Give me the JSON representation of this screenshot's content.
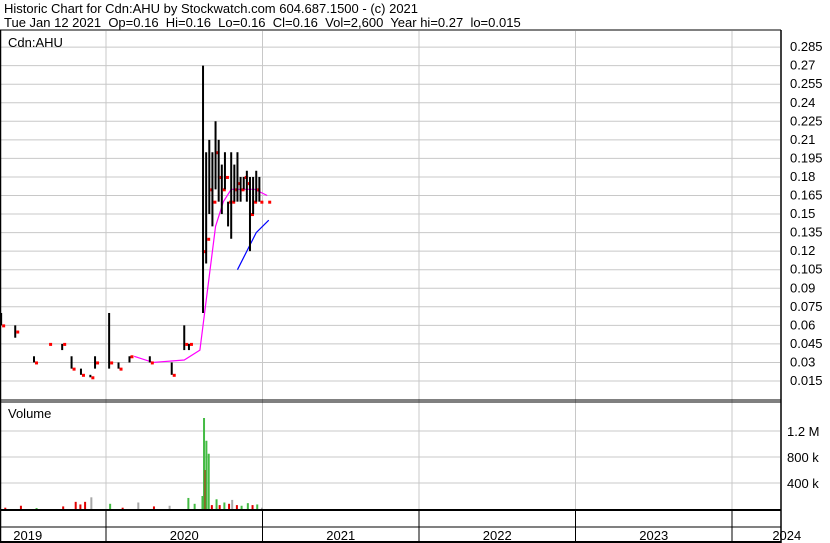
{
  "header": {
    "title": "Historic Chart for Cdn:AHU by Stockwatch.com 604.687.1500 - (c) 2021",
    "quote": "Tue Jan 12 2021  Op=0.16  Hi=0.16  Lo=0.16  Cl=0.16  Vol=2,600  Year hi=0.27  lo=0.015"
  },
  "chart_data": {
    "type": "ohlc",
    "symbol": "Cdn:AHU",
    "volume_label": "Volume",
    "y_ticks": [
      "0.285",
      "0.27",
      "0.255",
      "0.24",
      "0.225",
      "0.21",
      "0.195",
      "0.18",
      "0.165",
      "0.15",
      "0.135",
      "0.12",
      "0.105",
      "0.09",
      "0.075",
      "0.06",
      "0.045",
      "0.03",
      "0.015"
    ],
    "ylim": [
      0.015,
      0.285
    ],
    "vol_ticks": [
      {
        "label": "1.2 M",
        "v": 1200000
      },
      {
        "label": "800 k",
        "v": 800000
      },
      {
        "label": "400 k",
        "v": 400000
      }
    ],
    "x_labels": [
      {
        "label": "2019",
        "t": 2019.5
      },
      {
        "label": "2020",
        "t": 2020.5
      },
      {
        "label": "2021",
        "t": 2021.5
      },
      {
        "label": "2022",
        "t": 2022.5
      },
      {
        "label": "2023",
        "t": 2023.5
      },
      {
        "label": "2024",
        "t": 2024.35
      }
    ],
    "year_starts": [
      2020,
      2021,
      2022,
      2023,
      2024
    ],
    "bars": [
      [
        2019.33,
        0.07,
        0.06,
        0.06
      ],
      [
        2019.42,
        0.06,
        0.05,
        0.055
      ],
      [
        2019.54,
        0.035,
        0.03,
        0.03
      ],
      [
        2019.63,
        0.045,
        0.045,
        0.045
      ],
      [
        2019.72,
        0.045,
        0.04,
        0.045
      ],
      [
        2019.78,
        0.035,
        0.025,
        0.025
      ],
      [
        2019.84,
        0.025,
        0.02,
        0.02
      ],
      [
        2019.9,
        0.02,
        0.018,
        0.018
      ],
      [
        2019.93,
        0.035,
        0.025,
        0.03
      ],
      [
        2020.02,
        0.07,
        0.025,
        0.03
      ],
      [
        2020.08,
        0.03,
        0.025,
        0.025
      ],
      [
        2020.15,
        0.035,
        0.03,
        0.035
      ],
      [
        2020.28,
        0.035,
        0.03,
        0.03
      ],
      [
        2020.42,
        0.03,
        0.02,
        0.02
      ],
      [
        2020.5,
        0.06,
        0.04,
        0.045
      ],
      [
        2020.53,
        0.045,
        0.04,
        0.045
      ],
      [
        2020.62,
        0.27,
        0.07,
        0.12
      ],
      [
        2020.64,
        0.2,
        0.11,
        0.13
      ],
      [
        2020.66,
        0.21,
        0.15,
        0.17
      ],
      [
        2020.68,
        0.2,
        0.14,
        0.16
      ],
      [
        2020.7,
        0.225,
        0.17,
        0.2
      ],
      [
        2020.72,
        0.21,
        0.16,
        0.18
      ],
      [
        2020.74,
        0.19,
        0.15,
        0.17
      ],
      [
        2020.76,
        0.2,
        0.17,
        0.18
      ],
      [
        2020.78,
        0.16,
        0.14,
        0.16
      ],
      [
        2020.8,
        0.2,
        0.13,
        0.16
      ],
      [
        2020.82,
        0.19,
        0.16,
        0.17
      ],
      [
        2020.84,
        0.2,
        0.16,
        0.175
      ],
      [
        2020.86,
        0.18,
        0.16,
        0.17
      ],
      [
        2020.88,
        0.18,
        0.17,
        0.18
      ],
      [
        2020.9,
        0.185,
        0.16,
        0.175
      ],
      [
        2020.92,
        0.18,
        0.12,
        0.15
      ],
      [
        2020.94,
        0.18,
        0.15,
        0.16
      ],
      [
        2020.96,
        0.185,
        0.16,
        0.17
      ],
      [
        2020.98,
        0.18,
        0.16,
        0.16
      ],
      [
        2021.03,
        0.16,
        0.16,
        0.16
      ]
    ],
    "ma_fast": [
      [
        2020.18,
        0.035
      ],
      [
        2020.3,
        0.03
      ],
      [
        2020.5,
        0.032
      ],
      [
        2020.6,
        0.04
      ],
      [
        2020.66,
        0.1
      ],
      [
        2020.7,
        0.14
      ],
      [
        2020.75,
        0.16
      ],
      [
        2020.8,
        0.17
      ],
      [
        2020.86,
        0.17
      ],
      [
        2020.95,
        0.17
      ],
      [
        2021.03,
        0.165
      ]
    ],
    "ma_slow": [
      [
        2020.84,
        0.105
      ],
      [
        2020.9,
        0.12
      ],
      [
        2020.96,
        0.135
      ],
      [
        2021.04,
        0.145
      ]
    ],
    "volume": [
      [
        2019.35,
        20000,
        "#e00000"
      ],
      [
        2019.45,
        50000,
        "#e00000"
      ],
      [
        2019.55,
        15000,
        "#44bb44"
      ],
      [
        2019.72,
        40000,
        "#e00000"
      ],
      [
        2019.8,
        110000,
        "#e00000"
      ],
      [
        2019.83,
        70000,
        "#e00000"
      ],
      [
        2019.86,
        110000,
        "#e00000"
      ],
      [
        2019.9,
        180000,
        "#a8a8a8"
      ],
      [
        2020.02,
        80000,
        "#44bb44"
      ],
      [
        2020.1,
        20000,
        "#e00000"
      ],
      [
        2020.2,
        100000,
        "#a8a8a8"
      ],
      [
        2020.3,
        40000,
        "#e00000"
      ],
      [
        2020.4,
        50000,
        "#a8a8a8"
      ],
      [
        2020.52,
        170000,
        "#44bb44"
      ],
      [
        2020.56,
        80000,
        "#44bb44"
      ],
      [
        2020.61,
        200000,
        "#44bb44"
      ],
      [
        2020.62,
        1400000,
        "#44bb44"
      ],
      [
        2020.63,
        600000,
        "#e00000"
      ],
      [
        2020.635,
        1050000,
        "#44bb44"
      ],
      [
        2020.65,
        850000,
        "#44bb44"
      ],
      [
        2020.67,
        60000,
        "#e00000"
      ],
      [
        2020.7,
        150000,
        "#44bb44"
      ],
      [
        2020.72,
        60000,
        "#e00000"
      ],
      [
        2020.75,
        100000,
        "#44bb44"
      ],
      [
        2020.78,
        80000,
        "#e00000"
      ],
      [
        2020.8,
        140000,
        "#a8a8a8"
      ],
      [
        2020.83,
        60000,
        "#e00000"
      ],
      [
        2020.86,
        50000,
        "#44bb44"
      ],
      [
        2020.9,
        90000,
        "#44bb44"
      ],
      [
        2020.93,
        60000,
        "#e00000"
      ],
      [
        2020.96,
        70000,
        "#44bb44"
      ],
      [
        2020.99,
        20000,
        "#a8a8a8"
      ]
    ]
  }
}
